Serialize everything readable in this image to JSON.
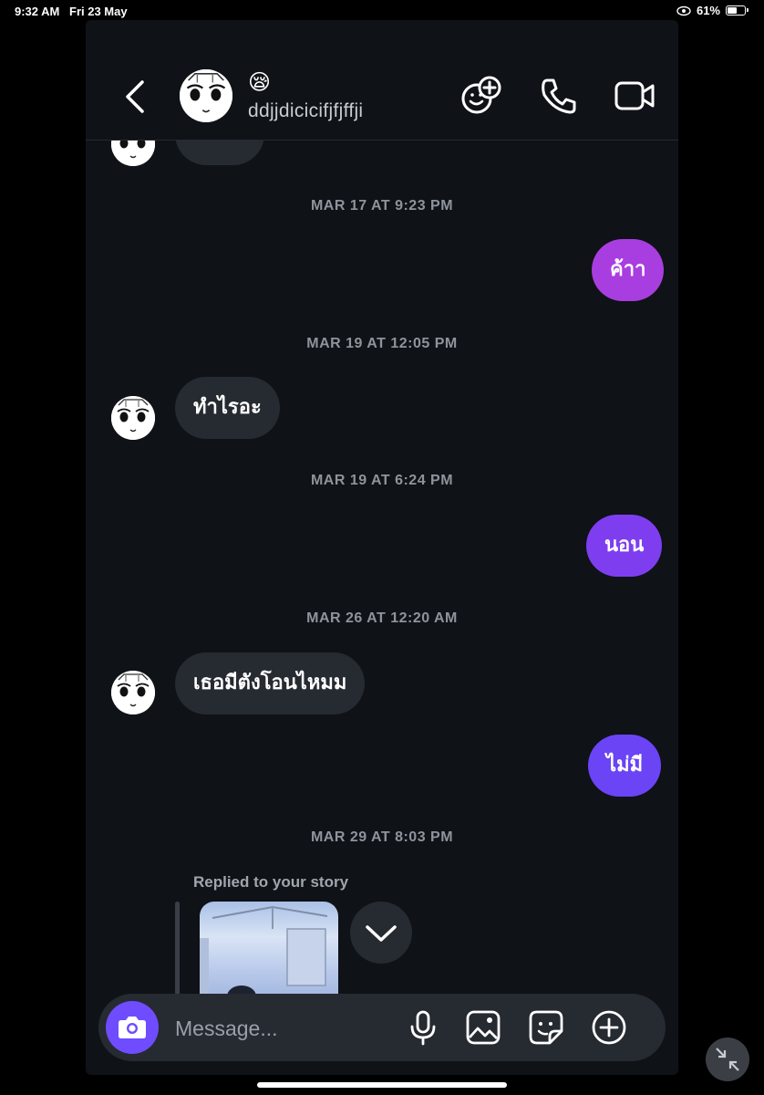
{
  "status_bar": {
    "time": "9:32 AM",
    "date": "Fri 23 May",
    "battery": "61%",
    "battery_level": 0.61
  },
  "header": {
    "status_emoji": "😪",
    "contact_name": "ddjjdicicifjfjffji",
    "icons": [
      "back-chevron-icon",
      "add-emoji-icon",
      "phone-icon",
      "video-camera-icon"
    ]
  },
  "messages": {
    "timestamps": [
      "MAR 17 AT 9:23 PM",
      "MAR 19 AT 12:05 PM",
      "MAR 19 AT 6:24 PM",
      "MAR 26 AT 12:20 AM",
      "MAR 29 AT 8:03 PM"
    ],
    "bubbles": [
      "ค้าา",
      "ทำไรอะ",
      "นอน",
      "เธอมีตังโอนไหมม",
      "ไม่มี"
    ],
    "reply_label": "Replied to your story"
  },
  "composer": {
    "placeholder": "Message...",
    "icons": [
      "camera-icon",
      "microphone-icon",
      "gallery-icon",
      "sticker-icon",
      "plus-circle-icon"
    ]
  },
  "colors": {
    "background": "#0f1217",
    "incoming_bubble": "#262a31",
    "outgoing_top": "#a93ee0",
    "outgoing_mid": "#7e3ef0",
    "outgoing_bottom": "#6a44f5",
    "camera_button": "#6f4cff"
  }
}
